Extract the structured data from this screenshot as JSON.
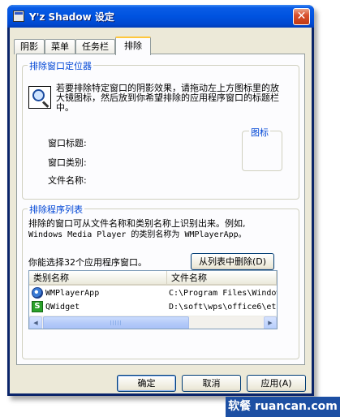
{
  "window": {
    "title": "Y'z Shadow 设定",
    "close_symbol": "✕"
  },
  "tabs": [
    {
      "label": "阴影",
      "active": false
    },
    {
      "label": "菜单",
      "active": false
    },
    {
      "label": "任务栏",
      "active": false
    },
    {
      "label": "排除",
      "active": true
    }
  ],
  "locator": {
    "group_title": "排除窗口定位器",
    "description": "若要排除特定窗口的阴影效果，请拖动左上方图标里的放大镜图标，然后放到你希望排除的应用程序窗口的标题栏中。",
    "icon_box_title": "图标",
    "fields": [
      {
        "label": "窗口标题:",
        "value": ""
      },
      {
        "label": "窗口类别:",
        "value": ""
      },
      {
        "label": "文件名称:",
        "value": ""
      }
    ]
  },
  "exclusion_list": {
    "group_title": "排除程序列表",
    "description_line1": "排除的窗口可从文件名称和类别名称上识别出来。例如,",
    "description_line2": "Windows Media Player 的类别名称为 WMPlayerApp。",
    "count_text": "你能选择32个应用程序窗口。",
    "remove_button": "从列表中删除(D)",
    "columns": [
      "类别名称",
      "文件名称"
    ],
    "rows": [
      {
        "icon": "media-player-icon",
        "class_name": "WMPlayerApp",
        "file_name": "C:\\Program Files\\Windows"
      },
      {
        "icon": "wps-icon",
        "class_name": "QWidget",
        "file_name": "D:\\soft\\wps\\office6\\et"
      }
    ],
    "scroll_left": "◀",
    "scroll_right": "▶"
  },
  "buttons": {
    "ok": "确定",
    "cancel": "取消",
    "apply": "应用(A)"
  },
  "watermark": {
    "text": "软餐 ruancan.com"
  },
  "colors": {
    "titlebar": "#0054e3",
    "group_title": "#0046d5",
    "client_bg": "#ece9d8",
    "active_tab_highlight": "#ffc73c"
  }
}
